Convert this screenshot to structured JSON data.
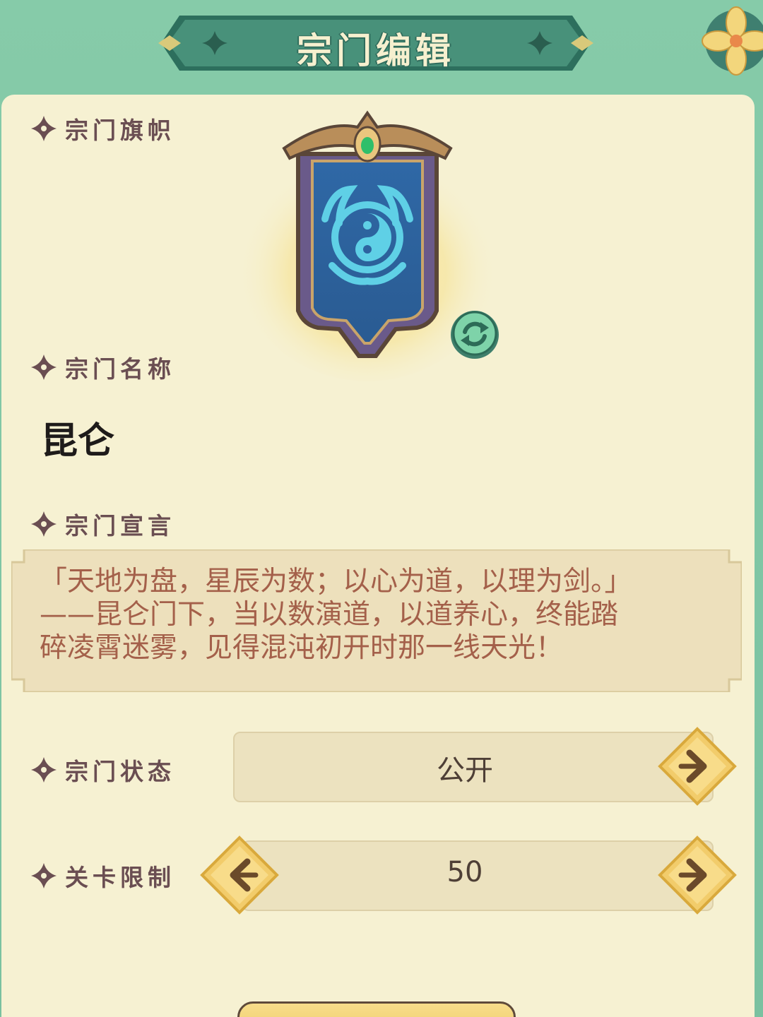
{
  "header": {
    "title": "宗门编辑",
    "corner_icon": "flower-icon"
  },
  "sections": {
    "banner_label": "宗门旗帜",
    "name_label": "宗门名称",
    "declaration_label": "宗门宣言",
    "status_label": "宗门状态",
    "level_limit_label": "关卡限制"
  },
  "banner": {
    "emblem_icon": "yin-yang-icon",
    "refresh_icon": "refresh-icon"
  },
  "sect": {
    "name": "昆仑",
    "declaration": "「天地为盘，星辰为数；以心为道，以理为剑。」\n——昆仑门下，当以数演道，以道养心，终能踏\n碎凌霄迷雾，见得混沌初开时那一线天光！",
    "status": "公开",
    "level_limit": "50"
  },
  "colors": {
    "background": "#7fc4a4",
    "panel": "#f6f1d2",
    "banner_dark": "#3f8a72",
    "label_text": "#6a4e52",
    "declaration_text": "#a4604a",
    "declaration_box": "#ede0bc",
    "arrow_gold": "#f2cc6b",
    "arrow_dark": "#6b4a2a",
    "refresh_green": "#6fc49a"
  }
}
